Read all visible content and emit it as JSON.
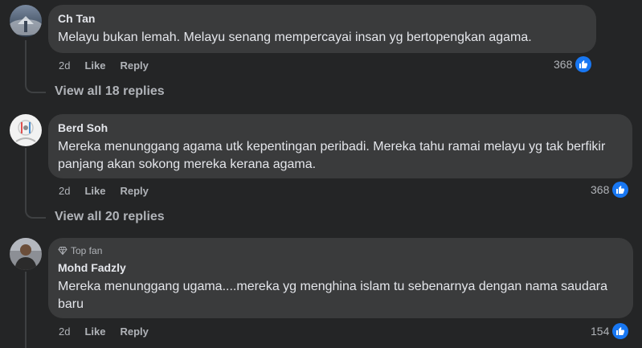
{
  "comments": [
    {
      "author": "Ch Tan",
      "badge": "",
      "text": "Melayu bukan lemah. Melayu senang mempercayai insan yg bertopengkan agama.",
      "time": "2d",
      "like_label": "Like",
      "reply_label": "Reply",
      "reaction_count": "368",
      "reaction_icon": "thumbs-up-icon",
      "view_replies": "View all 18 replies"
    },
    {
      "author": "Berd Soh",
      "badge": "",
      "text": "Mereka menunggang agama utk kepentingan peribadi. Mereka tahu ramai melayu yg tak berfikir panjang akan sokong mereka kerana agama.",
      "time": "2d",
      "like_label": "Like",
      "reply_label": "Reply",
      "reaction_count": "368",
      "reaction_icon": "thumbs-up-icon",
      "view_replies": "View all 20 replies"
    },
    {
      "author": "Mohd Fadzly",
      "badge": "Top fan",
      "badge_icon": "diamond-icon",
      "text": "Mereka menunggang ugama....mereka yg menghina islam tu sebenarnya dengan nama saudara baru",
      "time": "2d",
      "like_label": "Like",
      "reply_label": "Reply",
      "reaction_count": "154",
      "reaction_icon": "thumbs-up-icon"
    }
  ],
  "colors": {
    "background": "#242526",
    "bubble": "#3a3b3c",
    "text_primary": "#e4e6eb",
    "text_secondary": "#b0b3b8",
    "like_blue": "#1877f2"
  }
}
